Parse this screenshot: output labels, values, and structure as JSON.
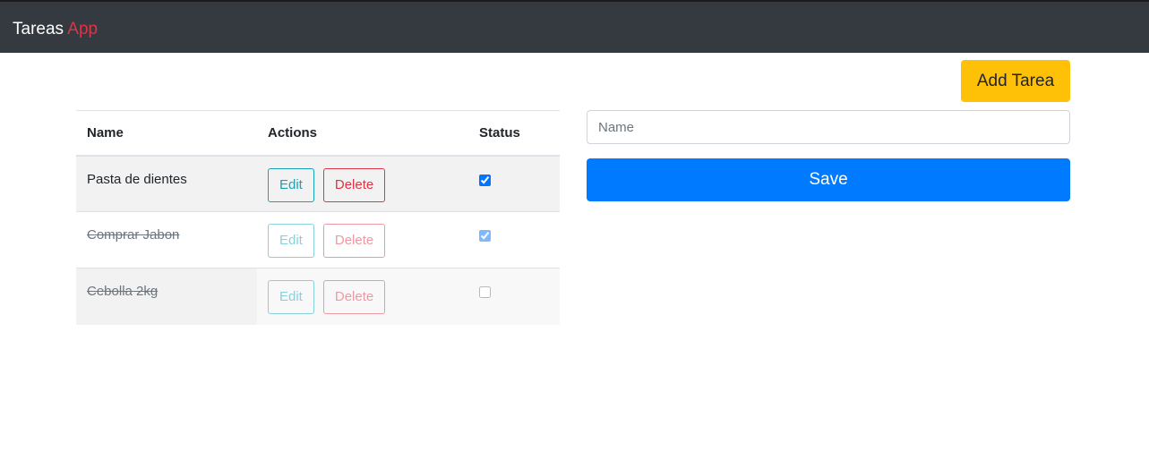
{
  "navbar": {
    "brand_main": "Tareas",
    "brand_accent": "App"
  },
  "table": {
    "headers": {
      "name": "Name",
      "actions": "Actions",
      "status": "Status"
    },
    "rows": [
      {
        "name": "Pasta de dientes",
        "edit": "Edit",
        "delete": "Delete",
        "checked": true,
        "completed": false
      },
      {
        "name": "Comprar Jabon",
        "edit": "Edit",
        "delete": "Delete",
        "checked": true,
        "completed": true
      },
      {
        "name": "Cebolla 2kg",
        "edit": "Edit",
        "delete": "Delete",
        "checked": false,
        "completed": true
      }
    ]
  },
  "form": {
    "add_button": "Add Tarea",
    "name_placeholder": "Name",
    "name_value": "",
    "save_button": "Save"
  },
  "colors": {
    "navbar": "#343a40",
    "accent": "#dc3545",
    "warning": "#ffc107",
    "primary": "#007bff",
    "info": "#17a2b8"
  }
}
